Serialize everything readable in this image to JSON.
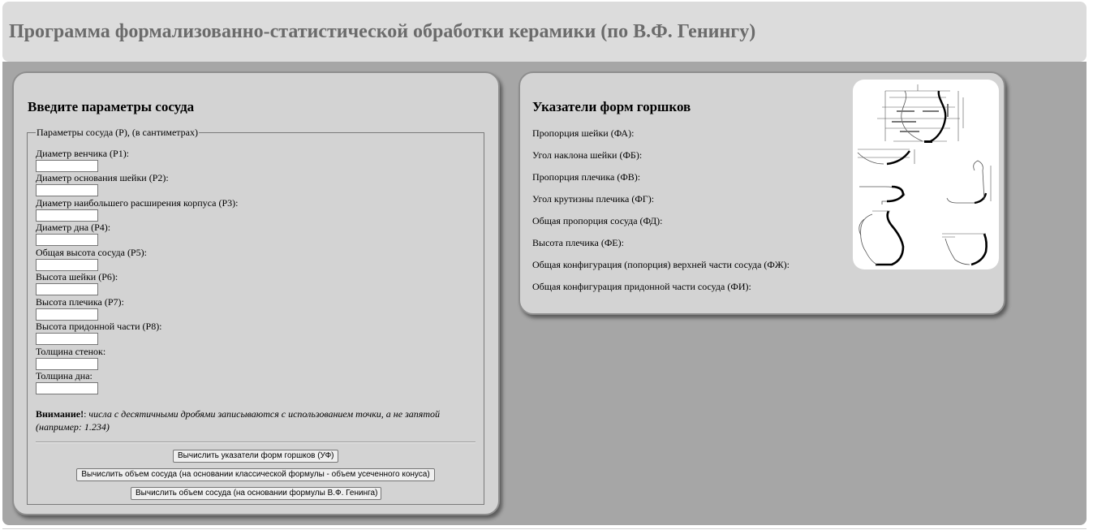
{
  "header": {
    "title": "Программа формализованно-статистической обработки керамики (по В.Ф. Генингу)"
  },
  "input_panel": {
    "heading": "Введите параметры сосуда",
    "legend": "Параметры сосуда (Р), (в сантиметрах)",
    "fields": [
      {
        "label": "Диаметр венчика (Р1):",
        "value": ""
      },
      {
        "label": "Диаметр основания шейки (Р2):",
        "value": ""
      },
      {
        "label": "Диаметр наибольшего расширения корпуса (Р3):",
        "value": ""
      },
      {
        "label": "Диаметр дна (Р4):",
        "value": ""
      },
      {
        "label": "Общая высота сосуда (Р5):",
        "value": ""
      },
      {
        "label": "Высота шейки (Р6):",
        "value": ""
      },
      {
        "label": "Высота плечика (Р7):",
        "value": ""
      },
      {
        "label": "Высота придонной части (Р8):",
        "value": ""
      },
      {
        "label": "Толщина стенок:",
        "value": ""
      },
      {
        "label": "Толщина дна:",
        "value": ""
      }
    ],
    "note_strong": "Внимание!",
    "note_sep": ":",
    "note_text": " числа с десятичными дробями записываются с использованием точки, а не запятой (например: 1.234)",
    "buttons": {
      "calc_indicators": "Вычислить указатели форм горшков (УФ)",
      "calc_volume_classic": "Вычислить объем сосуда (на основании классической формулы - объем усеченного конуса)",
      "calc_volume_gening": "Вычислить объем сосуда (на основании формулы В.Ф. Генинга)"
    }
  },
  "indicators_panel": {
    "heading": "Указатели форм горшков",
    "items": [
      {
        "label": "Пропорция шейки (ФА):",
        "value": ""
      },
      {
        "label": "Угол наклона шейки (ФБ):",
        "value": ""
      },
      {
        "label": "Пропорция плечика (ФВ):",
        "value": ""
      },
      {
        "label": "Угол крутизны плечика (ФГ):",
        "value": ""
      },
      {
        "label": "Общая пропорция сосуда (ФД):",
        "value": ""
      },
      {
        "label": "Высота плечика (ФЕ):",
        "value": ""
      },
      {
        "label": "Общая конфигурация (попорция) верхней части сосуда (ФЖ):",
        "value": ""
      },
      {
        "label": "Общая конфигурация придонной части сосуда (ФИ):",
        "value": ""
      }
    ]
  },
  "colors": {
    "header_bg": "#dcdcdc",
    "title_text": "#6b6b6b",
    "main_bg": "#a6a6a6",
    "panel_bg": "#d3d3d3"
  }
}
